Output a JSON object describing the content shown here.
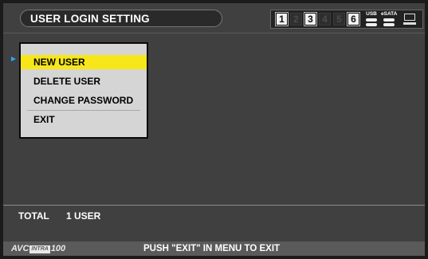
{
  "header": {
    "title": "USER LOGIN SETTING"
  },
  "status": {
    "slots": [
      {
        "label": "1",
        "active": true
      },
      {
        "label": "2",
        "active": false
      },
      {
        "label": "3",
        "active": true
      },
      {
        "label": "4",
        "active": false
      },
      {
        "label": "5",
        "active": false
      },
      {
        "label": "6",
        "active": true
      }
    ],
    "usb_label": "USB",
    "esata_label": "eSATA"
  },
  "menu": {
    "items": [
      {
        "label": "NEW USER",
        "selected": true
      },
      {
        "label": "DELETE USER",
        "selected": false
      },
      {
        "label": "CHANGE PASSWORD",
        "selected": false
      },
      {
        "label": "EXIT",
        "selected": false
      }
    ],
    "cursor_color": "#27a8ff",
    "highlight_color": "#f7e61a"
  },
  "summary": {
    "label": "TOTAL",
    "value": "1 USER"
  },
  "footer": {
    "logo": {
      "prefix": "AVC",
      "middle": "INTRA",
      "suffix": "100"
    },
    "message": "PUSH \"EXIT\" IN MENU TO EXIT"
  }
}
